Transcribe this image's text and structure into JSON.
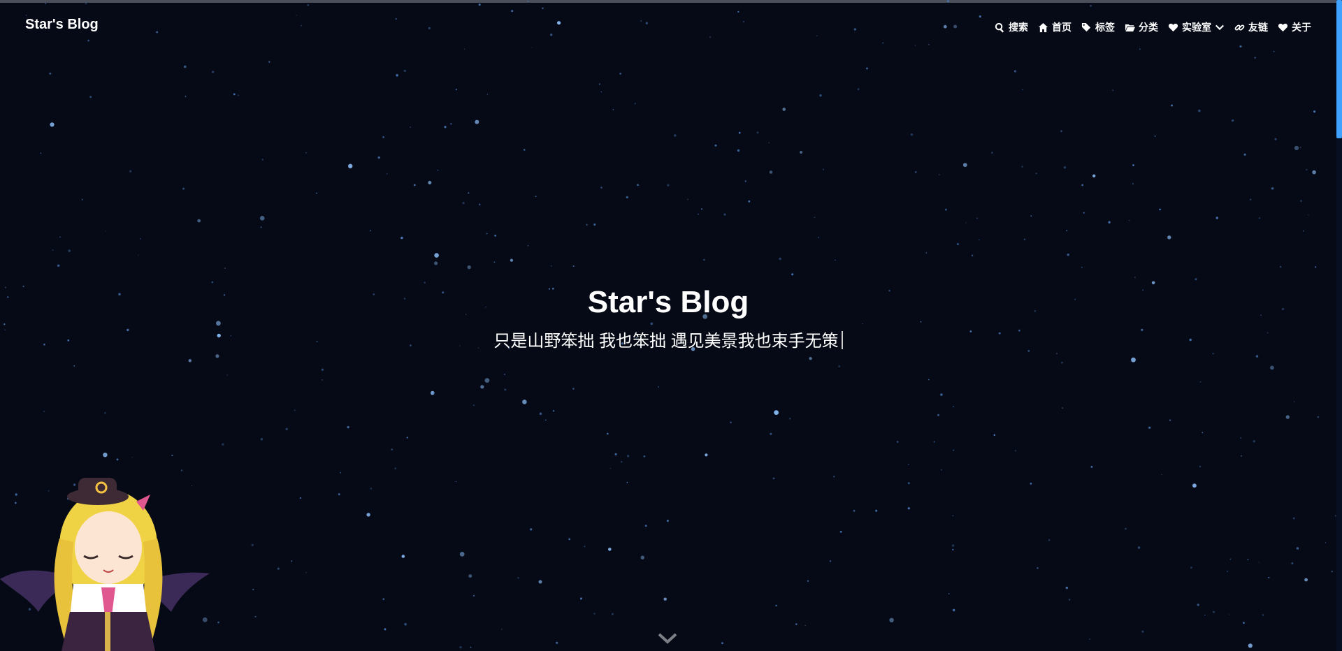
{
  "site": {
    "title": "Star's Blog"
  },
  "nav": {
    "items": [
      {
        "label": "搜索",
        "icon": "search-icon"
      },
      {
        "label": "首页",
        "icon": "home-icon"
      },
      {
        "label": "标签",
        "icon": "tags-icon"
      },
      {
        "label": "分类",
        "icon": "folder-icon"
      },
      {
        "label": "实验室",
        "icon": "heart-icon",
        "dropdown": true
      },
      {
        "label": "友链",
        "icon": "link-icon"
      },
      {
        "label": "关于",
        "icon": "heart-icon"
      }
    ]
  },
  "hero": {
    "title": "Star's Blog",
    "subtitle": "只是山野笨拙 我也笨拙 遇见美景我也束手无策"
  },
  "colors": {
    "background": "#050a16",
    "accent": "#3fa2ff"
  }
}
